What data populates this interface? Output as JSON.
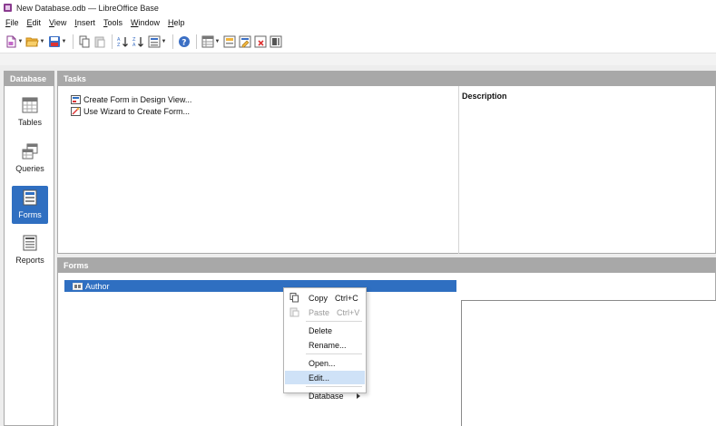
{
  "window": {
    "title": "New Database.odb — LibreOffice Base"
  },
  "menu": [
    {
      "label": "File",
      "mnemonic": "F"
    },
    {
      "label": "Edit",
      "mnemonic": "E"
    },
    {
      "label": "View",
      "mnemonic": "V"
    },
    {
      "label": "Insert",
      "mnemonic": "I"
    },
    {
      "label": "Tools",
      "mnemonic": "T"
    },
    {
      "label": "Window",
      "mnemonic": "W"
    },
    {
      "label": "Help",
      "mnemonic": "H"
    }
  ],
  "toolbar": {
    "icons": [
      "new-icon",
      "open-icon",
      "save-icon",
      "copy-icon",
      "paste-icon",
      "sort-ascending-icon",
      "sort-descending-icon",
      "form-icon",
      "help-icon",
      "table-icon",
      "report-icon",
      "edit-icon",
      "delete-icon",
      "rename-icon"
    ]
  },
  "database_panel": {
    "header": "Database",
    "items": [
      {
        "label": "Tables",
        "icon": "tables-icon",
        "active": false
      },
      {
        "label": "Queries",
        "icon": "queries-icon",
        "active": false
      },
      {
        "label": "Forms",
        "icon": "forms-icon",
        "active": true
      },
      {
        "label": "Reports",
        "icon": "reports-icon",
        "active": false
      }
    ]
  },
  "tasks_panel": {
    "header": "Tasks",
    "items": [
      {
        "label": "Create Form in Design View..."
      },
      {
        "label": "Use Wizard to Create Form..."
      }
    ],
    "description_label": "Description"
  },
  "forms_panel": {
    "header": "Forms",
    "items": [
      {
        "label": "Author"
      }
    ]
  },
  "context_menu": {
    "items": [
      {
        "label": "Copy",
        "shortcut": "Ctrl+C",
        "disabled": false
      },
      {
        "label": "Paste",
        "shortcut": "Ctrl+V",
        "disabled": true
      },
      {
        "label": "Delete",
        "shortcut": "",
        "disabled": false
      },
      {
        "label": "Rename...",
        "shortcut": "",
        "disabled": false
      },
      {
        "label": "Open...",
        "shortcut": "",
        "disabled": false
      },
      {
        "label": "Edit...",
        "shortcut": "",
        "disabled": false,
        "hover": true
      },
      {
        "label": "Database",
        "shortcut": "",
        "disabled": false,
        "submenu": true
      }
    ]
  },
  "colors": {
    "selection": "#2f6fc1",
    "panel_header": "#a8a8a8",
    "menu_hover": "#cfe2f7"
  }
}
